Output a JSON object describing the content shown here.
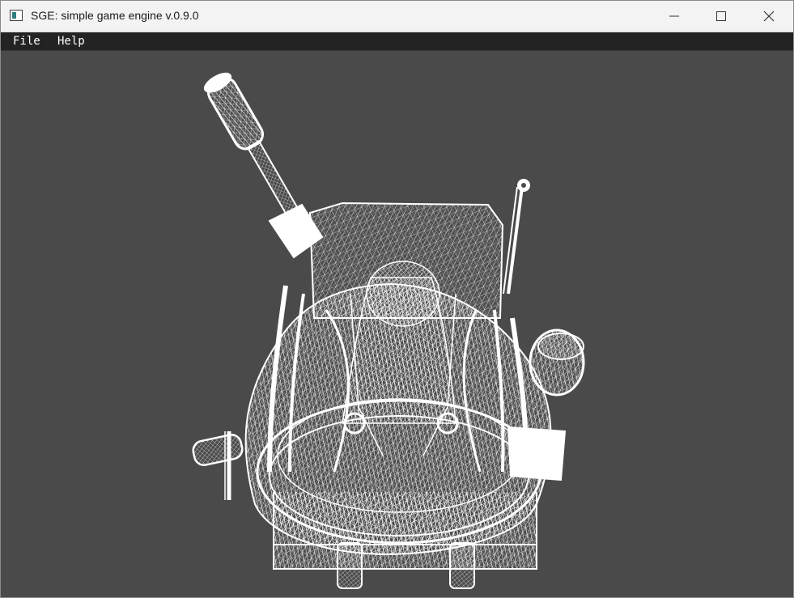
{
  "window": {
    "title": "SGE: simple game engine v.0.9.0",
    "icons": {
      "app": "app-window-icon",
      "minimize": "minimize-icon",
      "maximize": "maximize-icon",
      "close": "close-icon"
    }
  },
  "menubar": {
    "items": [
      {
        "label": "File"
      },
      {
        "label": "Help"
      }
    ]
  },
  "viewport": {
    "background": "#4a4a4a",
    "render_mode": "wireframe",
    "wire_color": "#ffffff",
    "model": "wireframe-backpack-model"
  }
}
